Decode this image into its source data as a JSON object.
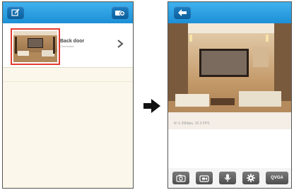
{
  "camera_list": {
    "items": [
      {
        "name": "Back door",
        "status": "Connected"
      }
    ]
  },
  "live_view": {
    "stream_info": "N~1.20kbps, 10.3 FPS",
    "resolution_label": "QVGA"
  },
  "icons": {
    "edit": "edit-icon",
    "add_camera": "add-camera-icon",
    "back": "back-arrow-icon",
    "snapshot": "camera-icon",
    "record": "video-record-icon",
    "microphone": "microphone-icon",
    "settings": "gear-icon",
    "transition": "right-arrow-icon"
  },
  "colors": {
    "header_blue": "#1d8fd6",
    "selection_red": "#e33b30",
    "background_cream": "#fbf7ea"
  }
}
